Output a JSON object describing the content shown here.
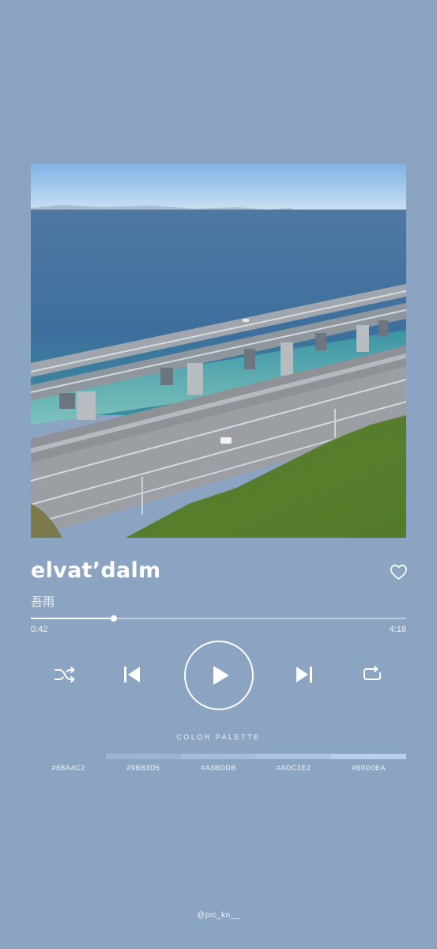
{
  "track": {
    "title": "elvat’dalm",
    "artist": "吾雨"
  },
  "playback": {
    "elapsed": "0:42",
    "total": "4:18",
    "progress_fraction": 0.22
  },
  "controls": {
    "shuffle_icon": "shuffle-icon",
    "previous_icon": "skip-previous-icon",
    "play_icon": "play-icon",
    "next_icon": "skip-next-icon",
    "repeat_icon": "repeat-icon",
    "favorite_icon": "heart-outline-icon"
  },
  "palette": {
    "heading": "COLOR PALETTE",
    "colors": [
      "#8BA4C2",
      "#9BB3D5",
      "#A3BDDB",
      "#ADC3E2",
      "#B9D0EA"
    ]
  },
  "credit": "@pic_kn__",
  "theme": {
    "background": "#8BA4C2",
    "foreground": "#FFFFFF"
  }
}
